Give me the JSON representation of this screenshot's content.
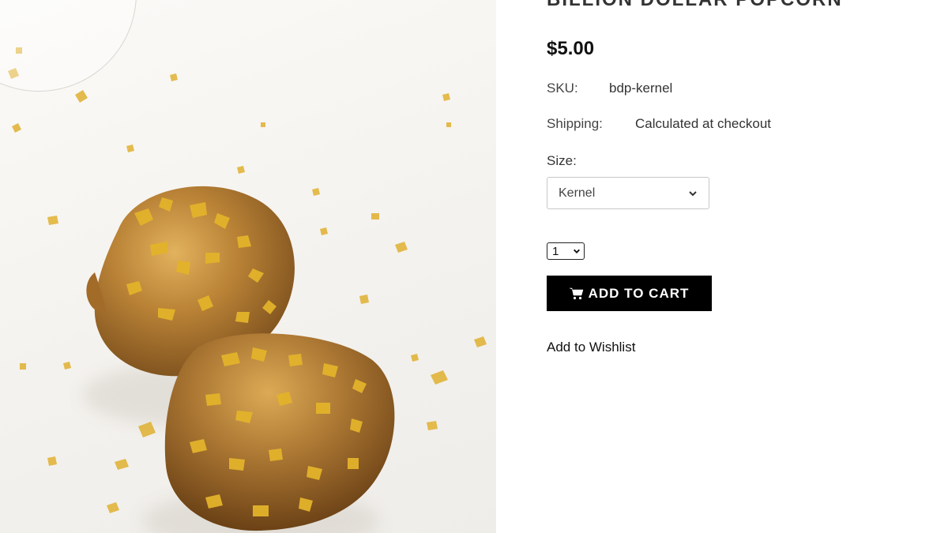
{
  "product": {
    "title": "Billion Dollar Popcorn",
    "price": "$5.00",
    "sku_label": "SKU:",
    "sku_value": "bdp-kernel",
    "shipping_label": "Shipping:",
    "shipping_value": "Calculated at checkout",
    "size_label": "Size:",
    "size_selected": "Kernel",
    "quantity_selected": "1",
    "add_to_cart_label": "ADD TO CART",
    "wishlist_label": "Add to Wishlist"
  },
  "icons": {
    "cart": "cart-icon",
    "size_dropdown": "chevron-down-icon",
    "qty_dropdown": "chevron-down-icon"
  },
  "colors": {
    "button_bg": "#000000",
    "button_text": "#ffffff",
    "gold": "#d9a520",
    "caramel": "#b07a2c"
  }
}
